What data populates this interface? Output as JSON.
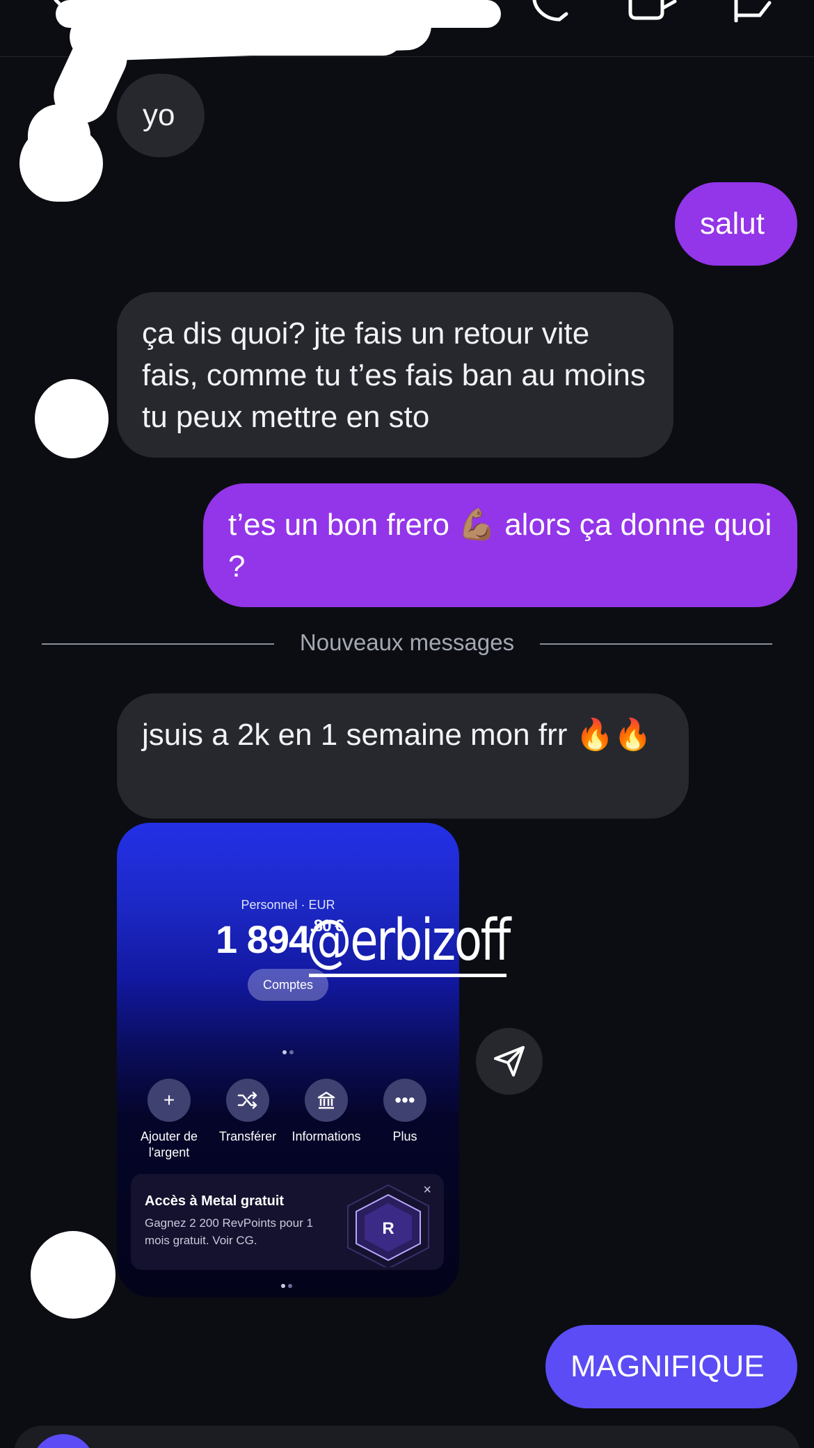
{
  "colors": {
    "background": "#0b0d12",
    "incoming_bubble": "#26282e",
    "outgoing_bubble": "#9335e8",
    "outgoing_bubble_latest": "#5b4cf5"
  },
  "header": {
    "icons": [
      "back-icon",
      "phone-icon",
      "video-icon",
      "flag-icon"
    ]
  },
  "messages": [
    {
      "from": "them",
      "text": "yo"
    },
    {
      "from": "me",
      "text": "salut"
    },
    {
      "from": "them",
      "text": "ça dis quoi? jte fais un retour vite fais, comme tu t’es fais ban au moins tu peux mettre en sto"
    },
    {
      "from": "me",
      "text": "t’es un bon frero 💪🏽 alors ça donne quoi ?"
    }
  ],
  "divider": {
    "label": "Nouveaux messages"
  },
  "new_messages": [
    {
      "from": "them",
      "text": "jsuis a 2k en 1 semaine mon frr 🔥🔥"
    },
    {
      "from": "me",
      "text": "MAGNIFIQUE"
    }
  ],
  "shared_image": {
    "account_label": "Personnel · EUR",
    "balance": "1 894",
    "balance_cents": ",80 €",
    "comptes_button": "Comptes",
    "actions": [
      {
        "label": "Ajouter de l'argent",
        "icon": "plus-icon"
      },
      {
        "label": "Transférer",
        "icon": "transfer-icon"
      },
      {
        "label": "Informations",
        "icon": "bank-icon"
      },
      {
        "label": "Plus",
        "icon": "more-icon"
      }
    ],
    "promo": {
      "title": "Accès à Metal gratuit",
      "body": "Gagnez 2 200 RevPoints pour 1 mois gratuit. Voir CG.",
      "close": "×",
      "logo_letter": "R"
    },
    "watermark": "@erbizoff"
  }
}
